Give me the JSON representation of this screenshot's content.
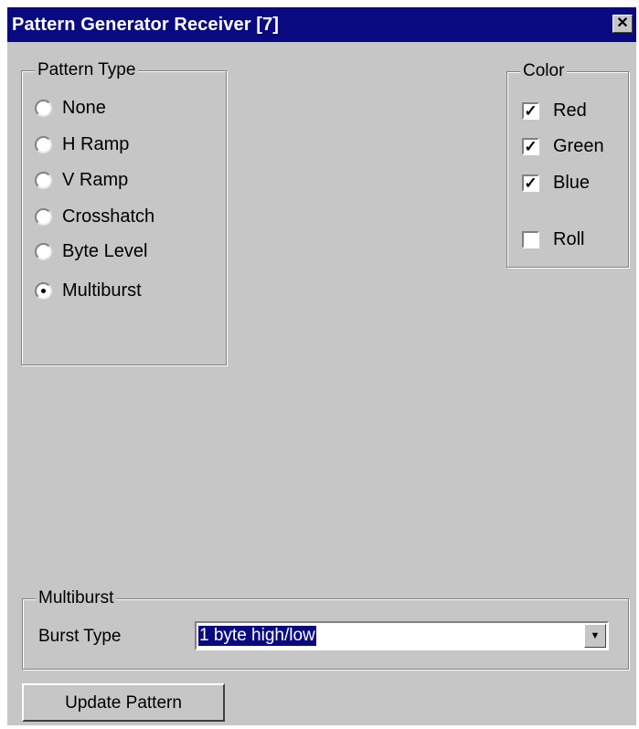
{
  "window": {
    "title": "Pattern Generator Receiver [7]",
    "close_label": "✕"
  },
  "pattern_type": {
    "legend": "Pattern Type",
    "options": [
      {
        "label": "None",
        "selected": false
      },
      {
        "label": "H Ramp",
        "selected": false
      },
      {
        "label": "V Ramp",
        "selected": false
      },
      {
        "label": "Crosshatch",
        "selected": false
      },
      {
        "label": "Byte Level",
        "selected": false
      },
      {
        "label": "Multiburst",
        "selected": true
      }
    ]
  },
  "color": {
    "legend": "Color",
    "options": [
      {
        "label": "Red",
        "checked": true
      },
      {
        "label": "Green",
        "checked": true
      },
      {
        "label": "Blue",
        "checked": true
      },
      {
        "label": "Roll",
        "checked": false
      }
    ]
  },
  "multiburst": {
    "legend": "Multiburst",
    "burst_type_label": "Burst Type",
    "burst_type_value": "1 byte high/low"
  },
  "update_button": {
    "label": "Update Pattern"
  },
  "icons": {
    "close": "close-icon",
    "dropdown": "chevron-down-icon",
    "check": "checkmark-icon"
  },
  "colors": {
    "titlebar": "#0a0a80",
    "face": "#c6c6c6",
    "selection": "#0a0a80"
  }
}
